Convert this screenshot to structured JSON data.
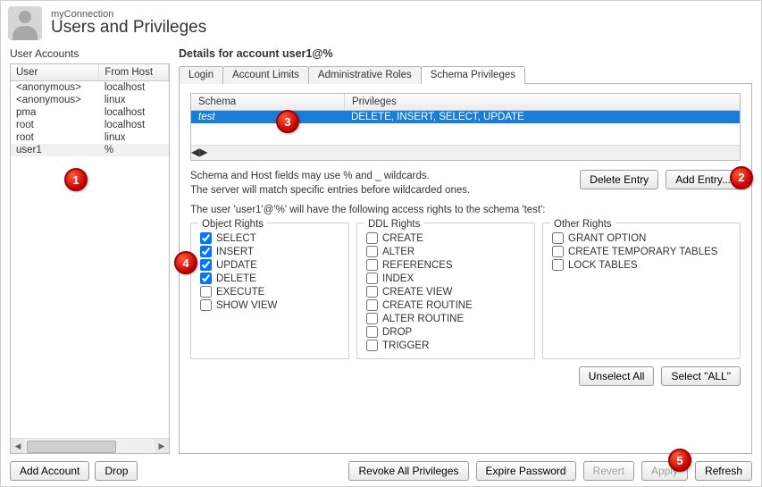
{
  "header": {
    "sub": "myConnection",
    "title": "Users and Privileges"
  },
  "sidebar": {
    "title": "User Accounts",
    "columns": {
      "user": "User",
      "host": "From Host"
    },
    "rows": [
      {
        "user": "<anonymous>",
        "host": "localhost"
      },
      {
        "user": "<anonymous>",
        "host": "linux"
      },
      {
        "user": "pma",
        "host": "localhost"
      },
      {
        "user": "root",
        "host": "localhost"
      },
      {
        "user": "root",
        "host": "linux"
      },
      {
        "user": "user1",
        "host": "%"
      }
    ],
    "buttons": {
      "add": "Add Account",
      "drop": "Drop"
    }
  },
  "main": {
    "title": "Details for account user1@%",
    "tabs": {
      "login": "Login",
      "limits": "Account Limits",
      "roles": "Administrative Roles",
      "schema": "Schema Privileges"
    },
    "schemaTable": {
      "cols": {
        "schema": "Schema",
        "priv": "Privileges"
      },
      "rows": [
        {
          "schema": "test",
          "priv": "DELETE, INSERT, SELECT, UPDATE"
        }
      ]
    },
    "hint1": "Schema and Host fields may use % and _ wildcards.",
    "hint2": "The server will match specific entries before wildcarded ones.",
    "accessLine": "The user 'user1'@'%' will have the following access rights to the schema 'test':",
    "entryBtns": {
      "del": "Delete Entry",
      "add": "Add Entry..."
    },
    "groups": {
      "object": {
        "legend": "Object Rights",
        "items": [
          {
            "label": "SELECT",
            "checked": true
          },
          {
            "label": "INSERT",
            "checked": true
          },
          {
            "label": "UPDATE",
            "checked": true
          },
          {
            "label": "DELETE",
            "checked": true
          },
          {
            "label": "EXECUTE",
            "checked": false
          },
          {
            "label": "SHOW VIEW",
            "checked": false
          }
        ]
      },
      "ddl": {
        "legend": "DDL Rights",
        "items": [
          {
            "label": "CREATE",
            "checked": false
          },
          {
            "label": "ALTER",
            "checked": false
          },
          {
            "label": "REFERENCES",
            "checked": false
          },
          {
            "label": "INDEX",
            "checked": false
          },
          {
            "label": "CREATE VIEW",
            "checked": false
          },
          {
            "label": "CREATE ROUTINE",
            "checked": false
          },
          {
            "label": "ALTER ROUTINE",
            "checked": false
          },
          {
            "label": "DROP",
            "checked": false
          },
          {
            "label": "TRIGGER",
            "checked": false
          }
        ]
      },
      "other": {
        "legend": "Other Rights",
        "items": [
          {
            "label": "GRANT OPTION",
            "checked": false
          },
          {
            "label": "CREATE TEMPORARY TABLES",
            "checked": false
          },
          {
            "label": "LOCK TABLES",
            "checked": false
          }
        ]
      }
    },
    "selectRow": {
      "unselect": "Unselect All",
      "all": "Select \"ALL\""
    },
    "footer": {
      "revoke": "Revoke All Privileges",
      "expire": "Expire Password",
      "revert": "Revert",
      "apply": "Apply",
      "refresh": "Refresh"
    }
  },
  "badges": [
    "1",
    "2",
    "3",
    "4",
    "5"
  ]
}
